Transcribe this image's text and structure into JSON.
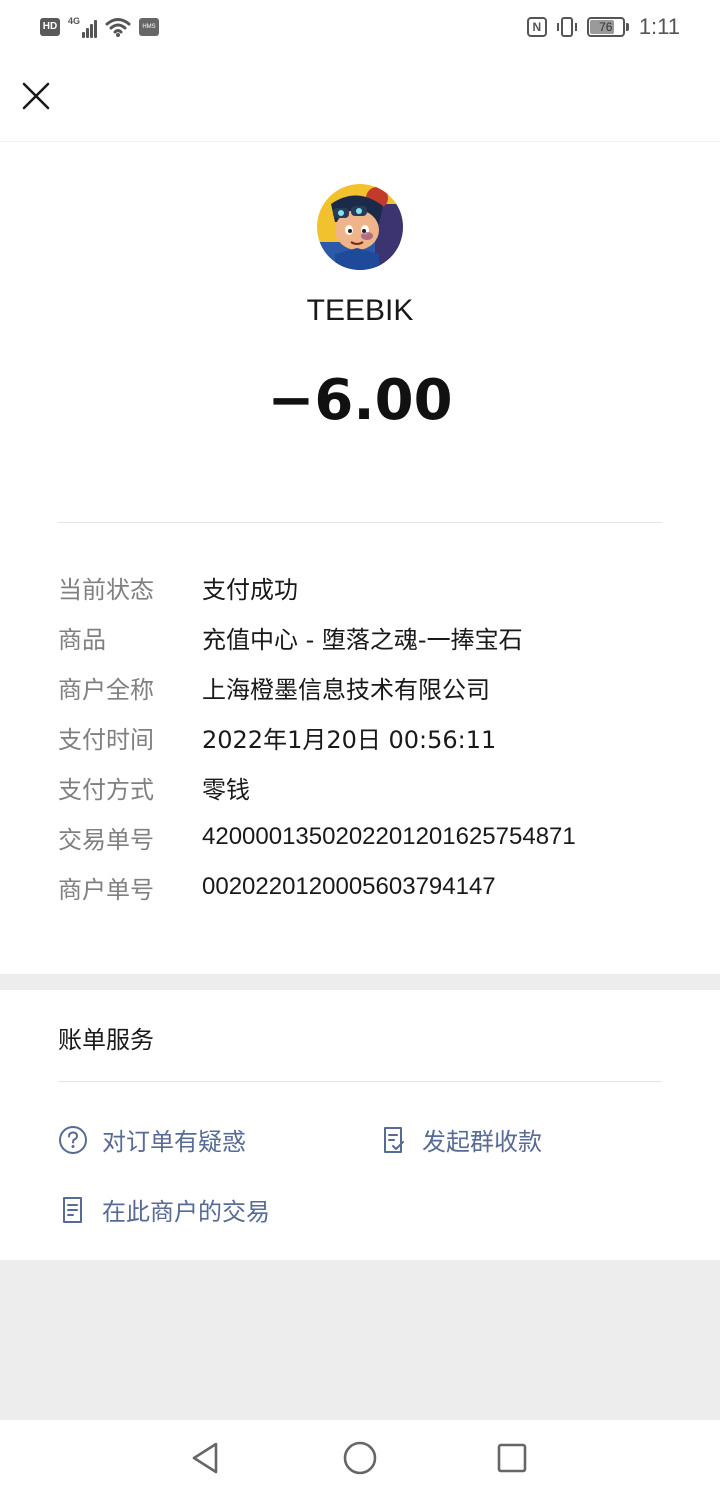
{
  "status_bar": {
    "hd": "HD",
    "network": "4G",
    "hms": "HMS",
    "nfc": "N",
    "battery": "76",
    "battery_level": 0.76,
    "time": "1:11"
  },
  "header": {
    "close_icon": "close-icon"
  },
  "merchant": {
    "name": "TEEBIK",
    "amount": "−6.00"
  },
  "details": [
    {
      "label": "当前状态",
      "value": "支付成功"
    },
    {
      "label": "商品",
      "value": "充值中心 - 堕落之魂-一捧宝石"
    },
    {
      "label": "商户全称",
      "value": "上海橙墨信息技术有限公司"
    },
    {
      "label": "支付时间",
      "value": "2022年1月20日 00:56:11"
    },
    {
      "label": "支付方式",
      "value": "零钱"
    },
    {
      "label": "交易单号",
      "value": "4200001350202201201625754871"
    },
    {
      "label": "商户单号",
      "value": "002022012000560379414​7"
    }
  ],
  "services": {
    "title": "账单服务",
    "links": [
      {
        "label": "对订单有疑惑",
        "icon": "question-circle-icon"
      },
      {
        "label": "发起群收款",
        "icon": "receipt-check-icon"
      },
      {
        "label": "在此商户的交易",
        "icon": "document-icon"
      }
    ]
  },
  "nav": {
    "back": "back-triangle-icon",
    "home": "home-circle-icon",
    "recents": "recents-square-icon"
  },
  "colors": {
    "link": "#576b95",
    "label": "#808080",
    "background": "#ededed"
  }
}
